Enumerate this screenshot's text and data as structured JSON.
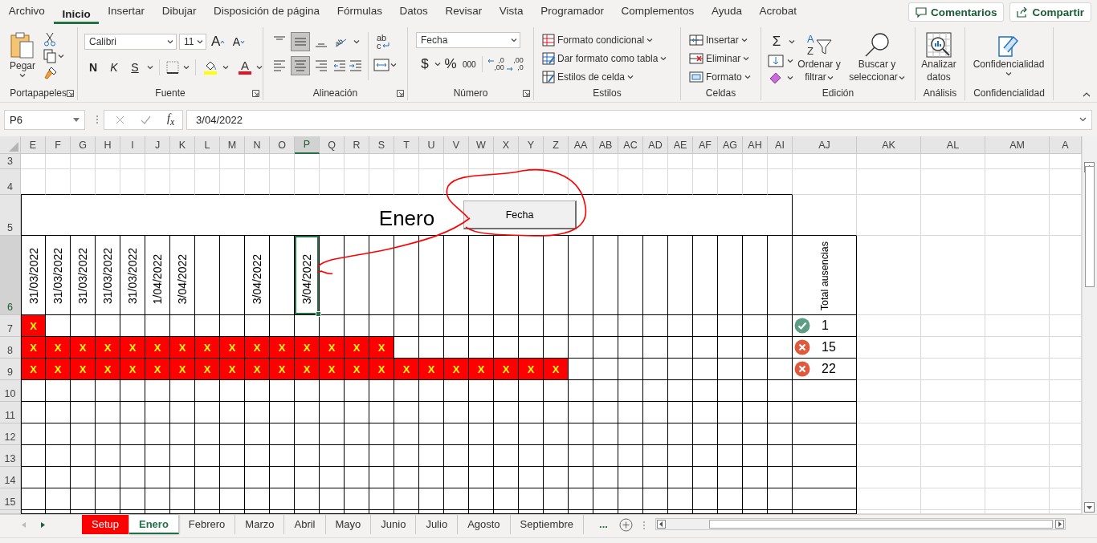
{
  "menu_tabs": [
    {
      "label": "Archivo",
      "selected": false
    },
    {
      "label": "Inicio",
      "selected": true
    },
    {
      "label": "Insertar",
      "selected": false
    },
    {
      "label": "Dibujar",
      "selected": false
    },
    {
      "label": "Disposición de página",
      "selected": false
    },
    {
      "label": "Fórmulas",
      "selected": false
    },
    {
      "label": "Datos",
      "selected": false
    },
    {
      "label": "Revisar",
      "selected": false
    },
    {
      "label": "Vista",
      "selected": false
    },
    {
      "label": "Programador",
      "selected": false
    },
    {
      "label": "Complementos",
      "selected": false
    },
    {
      "label": "Ayuda",
      "selected": false
    },
    {
      "label": "Acrobat",
      "selected": false
    }
  ],
  "header_buttons": [
    "Comentarios",
    "Compartir"
  ],
  "ribbon": {
    "clipboard": {
      "paste_label": "Pegar",
      "group_label": "Portapapeles"
    },
    "font": {
      "font_name": "Calibri",
      "font_size": "11",
      "grow_label": "A",
      "shrink_label": "A",
      "style_buttons": [
        "N",
        "K",
        "S"
      ],
      "font_color_label": "A",
      "group_label": "Fuente"
    },
    "alignment": {
      "vertical": [
        {
          "kind": "top",
          "selected": false
        },
        {
          "kind": "middle",
          "selected": true
        },
        {
          "kind": "bottom",
          "selected": false
        }
      ],
      "orientation_letters": "ab",
      "horizontal": [
        {
          "kind": "left",
          "selected": false
        },
        {
          "kind": "center",
          "selected": true
        },
        {
          "kind": "right",
          "selected": false
        }
      ],
      "wrap_lines": [
        "ab",
        "c"
      ],
      "group_label": "Alineación"
    },
    "number": {
      "format": "Fecha",
      "buttons": [
        "$",
        "%",
        "000"
      ],
      "decimal_buttons": [
        {
          "kind": "increase",
          "lines": [
            ",0",
            ",00"
          ]
        },
        {
          "kind": "decrease",
          "lines": [
            ",00",
            ",0"
          ]
        }
      ],
      "group_label": "Número"
    },
    "styles": {
      "items": [
        "Formato condicional",
        "Dar formato como tabla",
        "Estilos de celda"
      ],
      "group_label": "Estilos"
    },
    "cells": {
      "items": [
        "Insertar",
        "Eliminar",
        "Formato"
      ],
      "group_label": "Celdas"
    },
    "editing": {
      "sum_label": "Σ",
      "sort_icon_letters": [
        "A",
        "Z"
      ],
      "sort_lines": [
        "Ordenar y",
        "filtrar"
      ],
      "find_lines": [
        "Buscar y",
        "seleccionar"
      ],
      "group_label": "Edición"
    },
    "analysis": {
      "button_lines": [
        "Analizar",
        "datos"
      ],
      "group_label": "Análisis"
    },
    "sensitivity": {
      "button_label": "Confidencialidad",
      "group_label": "Confidencialidad"
    }
  },
  "formula_bar": {
    "name_box": "P6",
    "fx_label": "f$_{x}$",
    "value": "3/04/2022"
  },
  "sheet": {
    "columns": [
      {
        "label": "E",
        "selected": false
      },
      {
        "label": "F",
        "selected": false
      },
      {
        "label": "G",
        "selected": false
      },
      {
        "label": "H",
        "selected": false
      },
      {
        "label": "I",
        "selected": false
      },
      {
        "label": "J",
        "selected": false
      },
      {
        "label": "K",
        "selected": false
      },
      {
        "label": "L",
        "selected": false
      },
      {
        "label": "M",
        "selected": false
      },
      {
        "label": "N",
        "selected": false
      },
      {
        "label": "O",
        "selected": false
      },
      {
        "label": "P",
        "selected": true
      },
      {
        "label": "Q",
        "selected": false
      },
      {
        "label": "R",
        "selected": false
      },
      {
        "label": "S",
        "selected": false
      },
      {
        "label": "T",
        "selected": false
      },
      {
        "label": "U",
        "selected": false
      },
      {
        "label": "V",
        "selected": false
      },
      {
        "label": "W",
        "selected": false
      },
      {
        "label": "X",
        "selected": false
      },
      {
        "label": "Y",
        "selected": false
      },
      {
        "label": "Z",
        "selected": false
      },
      {
        "label": "AA",
        "selected": false
      },
      {
        "label": "AB",
        "selected": false
      },
      {
        "label": "AC",
        "selected": false
      },
      {
        "label": "AD",
        "selected": false
      },
      {
        "label": "AE",
        "selected": false
      },
      {
        "label": "AF",
        "selected": false
      },
      {
        "label": "AG",
        "selected": false
      },
      {
        "label": "AH",
        "selected": false
      },
      {
        "label": "AI",
        "selected": false
      },
      {
        "label": "AJ",
        "selected": false
      },
      {
        "label": "AK",
        "selected": false
      },
      {
        "label": "AL",
        "selected": false
      },
      {
        "label": "AM",
        "selected": false
      },
      {
        "label": "A",
        "selected": false
      }
    ],
    "rows": [
      {
        "label": "3",
        "selected": false
      },
      {
        "label": "4",
        "selected": false
      },
      {
        "label": "5",
        "selected": false
      },
      {
        "label": "6",
        "selected": true
      },
      {
        "label": "7",
        "selected": false
      },
      {
        "label": "8",
        "selected": false
      },
      {
        "label": "9",
        "selected": false
      },
      {
        "label": "10",
        "selected": false
      },
      {
        "label": "11",
        "selected": false
      },
      {
        "label": "12",
        "selected": false
      },
      {
        "label": "13",
        "selected": false
      },
      {
        "label": "14",
        "selected": false
      },
      {
        "label": "15",
        "selected": false
      }
    ],
    "title": "Enero",
    "button": "Fecha",
    "date_headers": [
      {
        "text": "31/03/2022",
        "selected": false
      },
      {
        "text": "31/03/2022",
        "selected": false
      },
      {
        "text": "31/03/2022",
        "selected": false
      },
      {
        "text": "31/03/2022",
        "selected": false
      },
      {
        "text": "31/03/2022",
        "selected": false
      },
      {
        "text": "1/04/2022",
        "selected": false
      },
      {
        "text": "3/04/2022",
        "selected": false
      },
      {
        "selected": false
      },
      {
        "selected": false
      },
      {
        "text": "3/04/2022",
        "selected": false
      },
      {
        "selected": false
      },
      {
        "text": "3/04/2022",
        "selected": true
      },
      {
        "selected": false
      },
      {
        "selected": false
      },
      {
        "selected": false
      },
      {
        "selected": false
      },
      {
        "selected": false
      },
      {
        "selected": false
      },
      {
        "selected": false
      },
      {
        "selected": false
      },
      {
        "selected": false
      },
      {
        "selected": false
      },
      {
        "selected": false
      },
      {
        "selected": false
      },
      {
        "selected": false
      },
      {
        "selected": false
      },
      {
        "selected": false
      },
      {
        "selected": false
      },
      {
        "selected": false
      },
      {
        "selected": false
      },
      {
        "selected": false
      }
    ],
    "total_header": "Total ausencias",
    "absence_rows": [
      {
        "marks": [
          "X"
        ],
        "kind": "ok",
        "total": "1"
      },
      {
        "marks": [
          "X",
          "X",
          "X",
          "X",
          "X",
          "X",
          "X",
          "X",
          "X",
          "X",
          "X",
          "X",
          "X",
          "X",
          "X"
        ],
        "kind": "error",
        "total": "15"
      },
      {
        "marks": [
          "X",
          "X",
          "X",
          "X",
          "X",
          "X",
          "X",
          "X",
          "X",
          "X",
          "X",
          "X",
          "X",
          "X",
          "X",
          "X",
          "X",
          "X",
          "X",
          "X",
          "X",
          "X"
        ],
        "kind": "error",
        "total": "22"
      }
    ]
  },
  "sheet_tabs": [
    {
      "label": "Setup",
      "selected": false,
      "color": "#ff0000"
    },
    {
      "label": "Enero",
      "selected": true
    },
    {
      "label": "Febrero",
      "selected": false
    },
    {
      "label": "Marzo",
      "selected": false
    },
    {
      "label": "Abril",
      "selected": false
    },
    {
      "label": "Mayo",
      "selected": false
    },
    {
      "label": "Junio",
      "selected": false
    },
    {
      "label": "Julio",
      "selected": false
    },
    {
      "label": "Agosto",
      "selected": false
    },
    {
      "label": "Septiembre",
      "selected": false
    }
  ],
  "more_tabs": "..."
}
